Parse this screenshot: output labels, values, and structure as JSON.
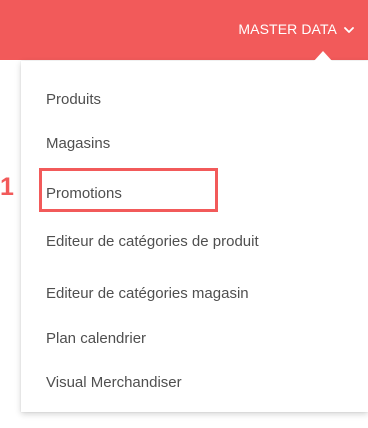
{
  "header": {
    "menu_label": "MASTER DATA",
    "chevron_icon": "chevron-down-icon",
    "accent_color": "#f25a5a"
  },
  "dropdown": {
    "items": [
      {
        "label": "Produits"
      },
      {
        "label": "Magasins"
      },
      {
        "label": "Promotions"
      },
      {
        "label": "Editeur de catégories de produit"
      },
      {
        "label": "Editeur de catégories magasin"
      },
      {
        "label": "Plan calendrier"
      },
      {
        "label": "Visual Merchandiser"
      }
    ]
  },
  "annotation": {
    "step_number": "1",
    "highlight_color": "#f25a5a"
  }
}
